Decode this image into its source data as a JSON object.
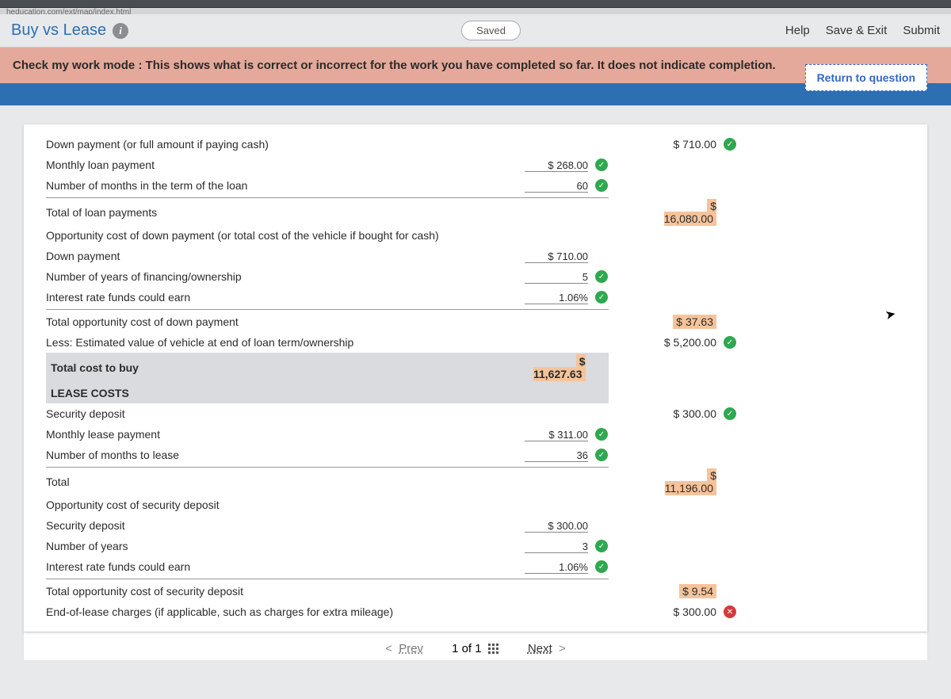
{
  "url_fragment": "heducation.com/ext/map/index.html",
  "title": "Buy vs Lease",
  "saved_label": "Saved",
  "top_actions": {
    "help": "Help",
    "save_exit": "Save & Exit",
    "submit": "Submit"
  },
  "banner": "Check my work mode : This shows what is correct or incorrect for the work you have completed so far. It does not indicate completion.",
  "return_btn": "Return to question",
  "rows": {
    "r0_label": "Down payment (or full amount if paying cash)",
    "r0_out": "$   710.00",
    "r1_label": "Monthly loan payment",
    "r1_in": "$  268.00",
    "r2_label": "Number of months in the term of the loan",
    "r2_in": "60",
    "r3_label": "Total of loan payments",
    "r3_out_sym": "$",
    "r3_out_val": "16,080.00",
    "r4_label": "Opportunity cost of down payment (or total cost of the vehicle if bought for cash)",
    "r5_label": "Down payment",
    "r5_in": "$  710.00",
    "r6_label": "Number of years of financing/ownership",
    "r6_in": "5",
    "r7_label": "Interest rate funds could earn",
    "r7_in": "1.06%",
    "r8_label": "Total opportunity cost of down payment",
    "r8_out": "$     37.63",
    "r9_label": "Less: Estimated value of vehicle at end of loan term/ownership",
    "r9_out": "$ 5,200.00",
    "r10_label": "Total cost to buy",
    "r10_out_sym": "$",
    "r10_out_val": "11,627.63",
    "r11_hdr": "LEASE COSTS",
    "r12_label": "Security deposit",
    "r12_out": "$   300.00",
    "r13_label": "Monthly lease payment",
    "r13_in": "$  311.00",
    "r14_label": "Number of months to lease",
    "r14_in": "36",
    "r15_label": "Total",
    "r15_out_sym": "$",
    "r15_out_val": "11,196.00",
    "r16_label": "Opportunity cost of security deposit",
    "r17_label": "Security deposit",
    "r17_in": "$  300.00",
    "r18_label": "Number of years",
    "r18_in": "3",
    "r19_label": "Interest rate funds could earn",
    "r19_in": "1.06%",
    "r20_label": "Total opportunity cost of security deposit",
    "r20_out": "$       9.54",
    "r21_label": "End-of-lease charges (if applicable, such as charges for extra mileage)",
    "r21_out": "$   300.00"
  },
  "nav": {
    "prev": "Prev",
    "counter": "1 of 1",
    "next": "Next"
  }
}
